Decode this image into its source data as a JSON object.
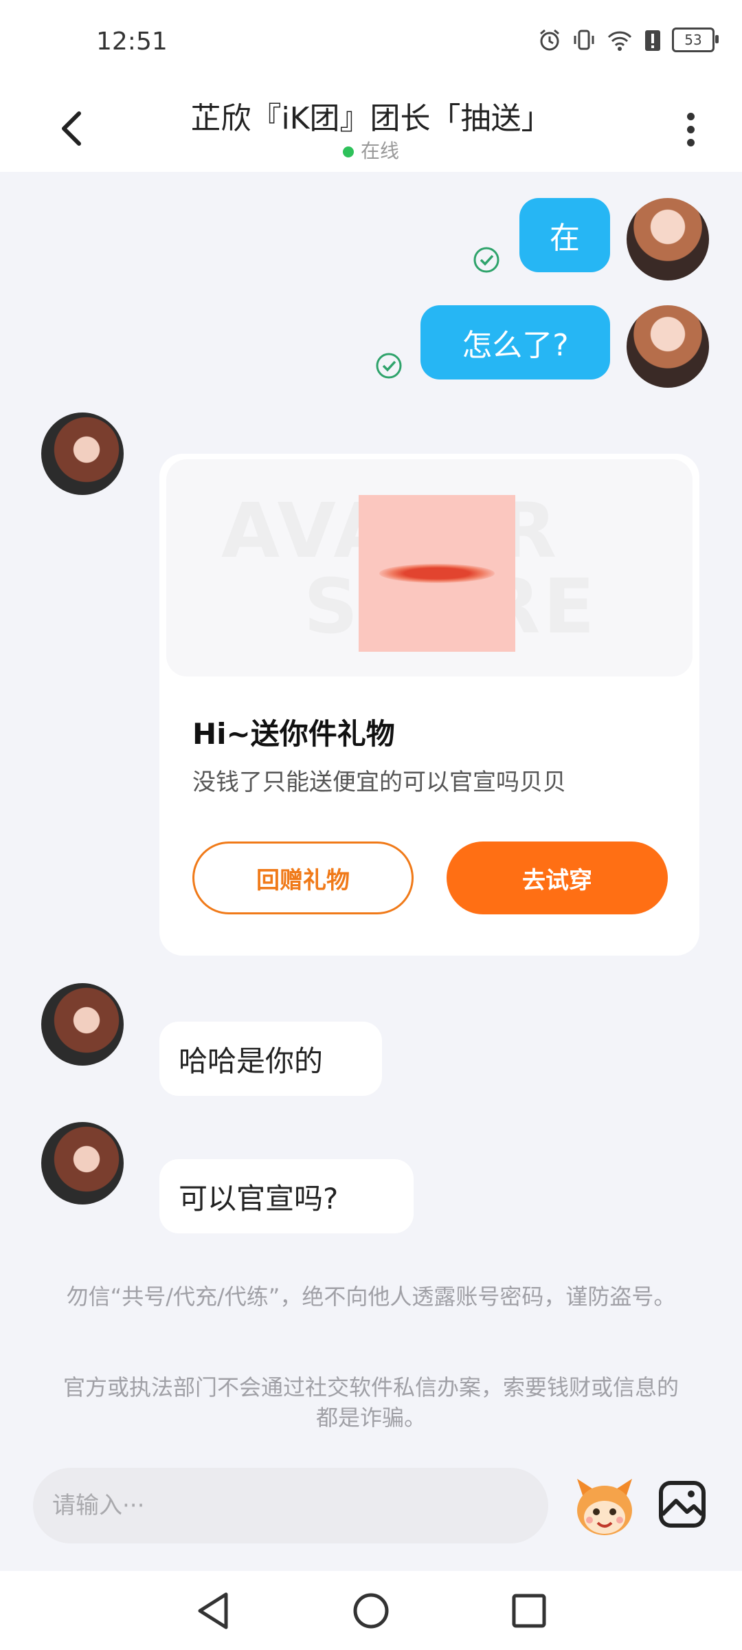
{
  "status_bar": {
    "time": "12:51",
    "battery": "53",
    "icons": [
      "alarm-icon",
      "vibrate-icon",
      "wifi-icon",
      "battery-alert-icon",
      "battery-icon"
    ]
  },
  "header": {
    "title": "芷欣『iK团』团长「抽送」",
    "status": "在线",
    "status_color": "#2ec15a"
  },
  "messages": {
    "me_1": "在",
    "me_2": "怎么了?",
    "gift_card": {
      "watermark_line1": "AVATAR",
      "watermark_line2": "STORE",
      "title": "Hi~送你件礼物",
      "description": "没钱了只能送便宜的可以官宣吗贝贝",
      "return_gift_button": "回赠礼物",
      "try_on_button": "去试穿"
    },
    "other_1": "哈哈是你的",
    "other_2": "可以官宣吗?"
  },
  "notices": {
    "notice_1": "勿信“共号/代充/代练”，绝不向他人透露账号密码，谨防盗号。",
    "notice_2": "官方或执法部门不会通过社交软件私信办案，索要钱财或信息的都是诈骗。"
  },
  "input": {
    "placeholder": "请输入···"
  },
  "colors": {
    "accent_blue": "#26b6f4",
    "accent_orange": "#ff6f14",
    "check_green": "#2ea36b"
  }
}
